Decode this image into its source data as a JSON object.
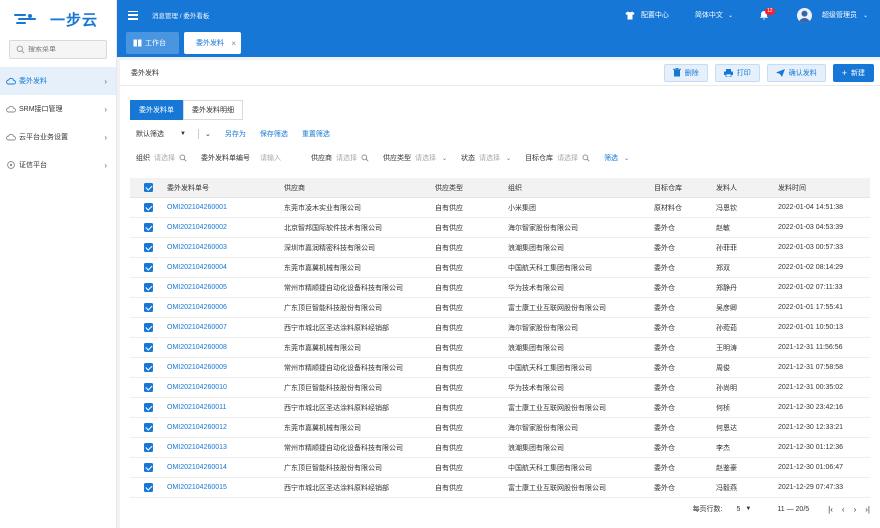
{
  "brand": {
    "logo_text": "一步云"
  },
  "sidebar": {
    "search_placeholder": "搜索菜单",
    "items": [
      {
        "label": "委外发料",
        "active": true
      },
      {
        "label": "SRM接口管理",
        "active": false
      },
      {
        "label": "云平台业务设置",
        "active": false
      },
      {
        "label": "证信平台",
        "active": false
      }
    ]
  },
  "header": {
    "breadcrumb": "消息管理 / 委外看板",
    "config_center": "配置中心",
    "language": "简体中文",
    "notification_count": "12",
    "user": "超级管理员"
  },
  "tabs": {
    "workbench": "工作台",
    "current": "委外发料"
  },
  "page": {
    "title": "委外发料",
    "buttons": {
      "delete": "删除",
      "print": "打印",
      "confirm": "确认发料",
      "new": "新建"
    }
  },
  "subtabs": [
    "委外发料单",
    "委外发料明细"
  ],
  "filters": {
    "default_filter": "默认筛选",
    "save_as": "另存为",
    "save_filter": "保存筛选",
    "reset_filter": "重置筛选",
    "org_label": "组织",
    "org_ph": "请选择",
    "code_label": "委外发料单编号",
    "code_ph": "请输入",
    "supplier_label": "供应商",
    "supplier_ph": "请选择",
    "supply_type_label": "供应类型",
    "supply_type_ph": "请选择",
    "status_label": "状态",
    "status_ph": "请选择",
    "warehouse_label": "目标仓库",
    "warehouse_ph": "请选择",
    "filter_link": "筛选"
  },
  "table": {
    "headers": [
      "委外发料单号",
      "供应商",
      "供应类型",
      "组织",
      "目标仓库",
      "发料人",
      "发料时间"
    ],
    "rows": [
      [
        "OMI202104260001",
        "东莞市凌木实业有限公司",
        "自有供应",
        "小米集团",
        "原材料仓",
        "冯恩钦",
        "2022-01-04 14:51:38"
      ],
      [
        "OMI202104260002",
        "北京智邦国际软件技术有限公司",
        "自有供应",
        "海尔智家股份有限公司",
        "委外仓",
        "赵敏",
        "2022-01-03 04:53:39"
      ],
      [
        "OMI202104260003",
        "深圳市嘉润精密科技有限公司",
        "自有供应",
        "浪潮集团有限公司",
        "委外仓",
        "孙菲菲",
        "2022-01-03 00:57:33"
      ],
      [
        "OMI202104260004",
        "东莞市嘉翼机械有限公司",
        "自有供应",
        "中国航天科工集团有限公司",
        "委外仓",
        "郑双",
        "2022-01-02 08:14:29"
      ],
      [
        "OMI202104260005",
        "常州市精顺捷自动化设备科技有限公司",
        "自有供应",
        "华为技术有限公司",
        "委外仓",
        "郑静丹",
        "2022-01-02 07:11:33"
      ],
      [
        "OMI202104260006",
        "广东顶巨智能科技股份有限公司",
        "自有供应",
        "富士康工业互联网股份有限公司",
        "委外仓",
        "吴彦卿",
        "2022-01-01 17:55:41"
      ],
      [
        "OMI202104260007",
        "西宁市城北区圣达涂料原料经销部",
        "自有供应",
        "海尔智家股份有限公司",
        "委外仓",
        "孙菀茹",
        "2022-01-01 10:50:13"
      ],
      [
        "OMI202104260008",
        "东莞市嘉翼机械有限公司",
        "自有供应",
        "浪潮集团有限公司",
        "委外仓",
        "王明涛",
        "2021-12-31 11:56:56"
      ],
      [
        "OMI202104260009",
        "常州市精顺捷自动化设备科技有限公司",
        "自有供应",
        "中国航天科工集团有限公司",
        "委外仓",
        "周俊",
        "2021-12-31 07:58:58"
      ],
      [
        "OMI202104260010",
        "广东顶巨智能科技股份有限公司",
        "自有供应",
        "华为技术有限公司",
        "委外仓",
        "孙尚明",
        "2021-12-31 00:35:02"
      ],
      [
        "OMI202104260011",
        "西宁市城北区圣达涂料原料经销部",
        "自有供应",
        "富士康工业互联网股份有限公司",
        "委外仓",
        "何桢",
        "2021-12-30 23:42:16"
      ],
      [
        "OMI202104260012",
        "东莞市嘉翼机械有限公司",
        "自有供应",
        "海尔智家股份有限公司",
        "委外仓",
        "何恩达",
        "2021-12-30 12:33:21"
      ],
      [
        "OMI202104260013",
        "常州市精顺捷自动化设备科技有限公司",
        "自有供应",
        "浪潮集团有限公司",
        "委外仓",
        "李杰",
        "2021-12-30 01:12:36"
      ],
      [
        "OMI202104260014",
        "广东顶巨智能科技股份有限公司",
        "自有供应",
        "中国航天科工集团有限公司",
        "委外仓",
        "赵鉴豪",
        "2021-12-30 01:06:47"
      ],
      [
        "OMI202104260015",
        "西宁市城北区圣达涂料原料经销部",
        "自有供应",
        "富士康工业互联网股份有限公司",
        "委外仓",
        "冯毅燕",
        "2021-12-29 07:47:33"
      ]
    ]
  },
  "pagination": {
    "page_size_label": "每页行数:",
    "page_size": "5",
    "range": "11 — 20/5"
  },
  "colors": {
    "primary": "#1677d6",
    "header_bg": "#1677d6"
  }
}
